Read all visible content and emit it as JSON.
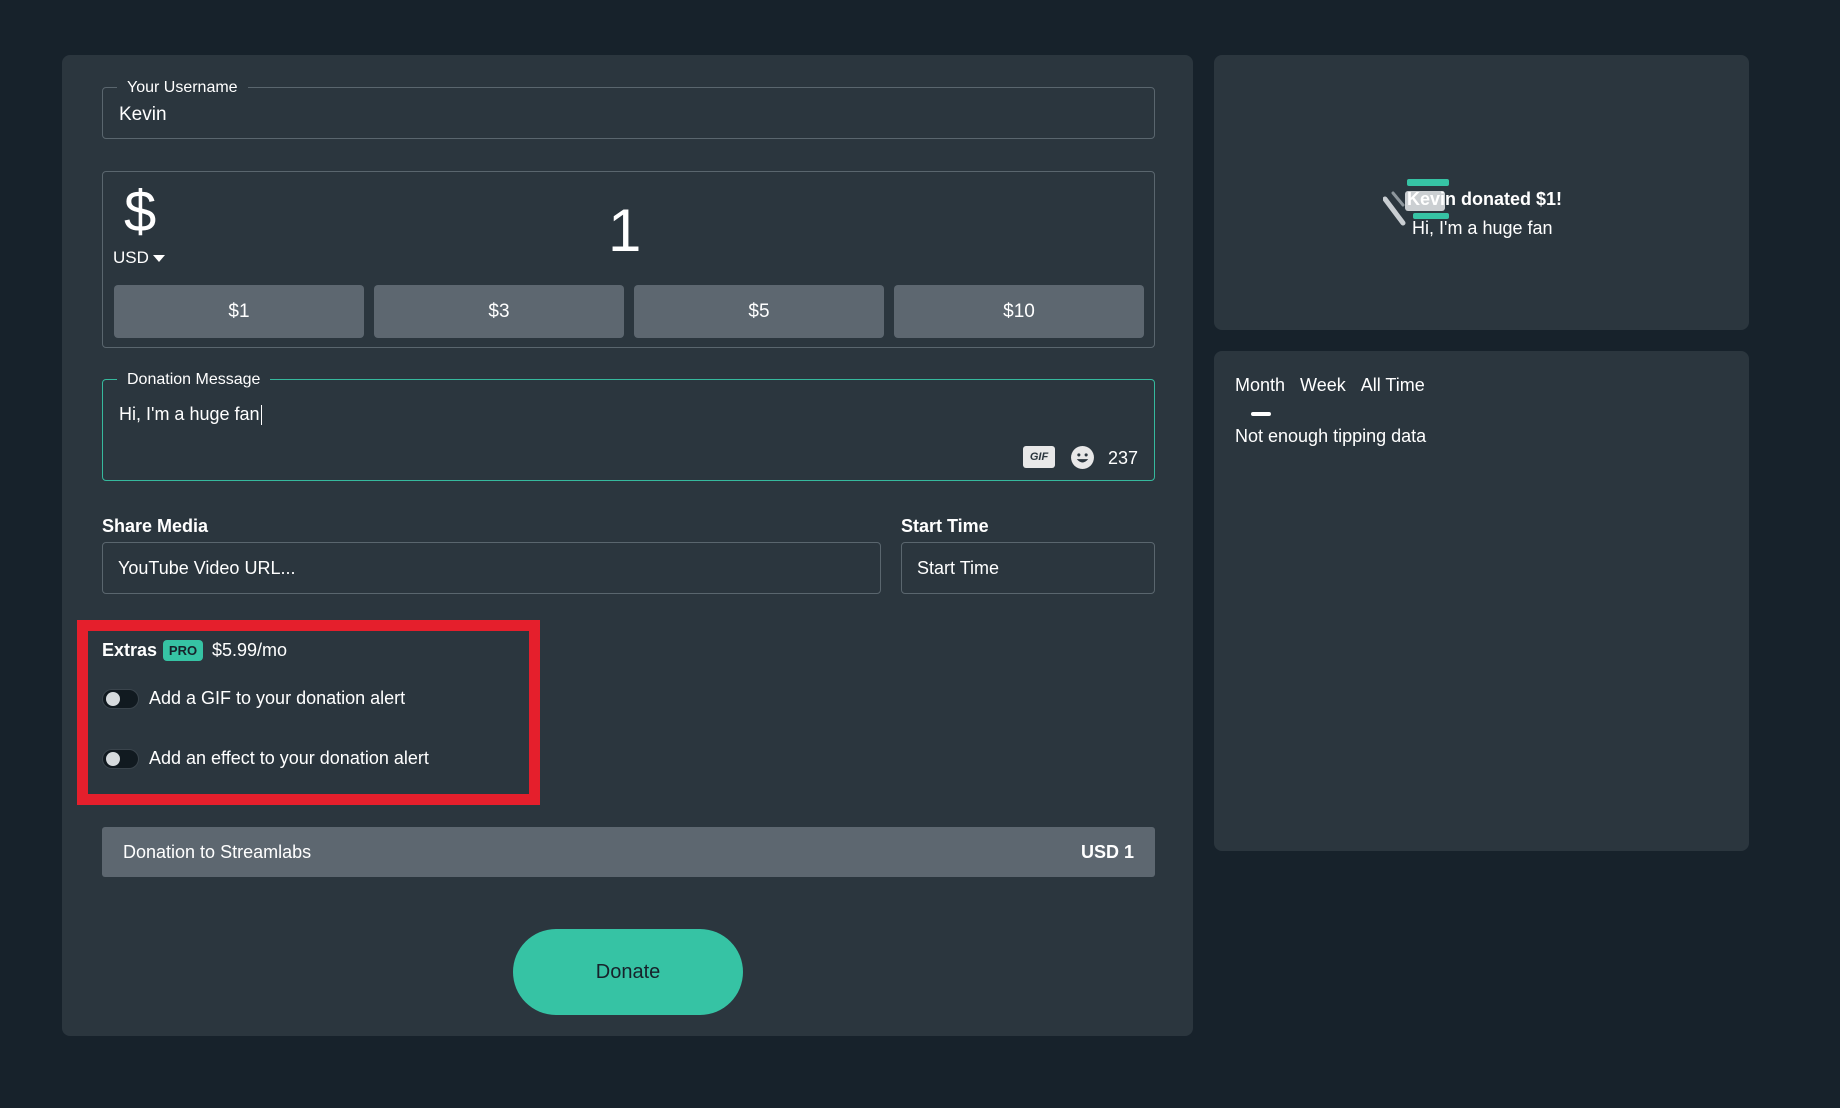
{
  "form": {
    "username_label": "Your Username",
    "username_value": "Kevin",
    "currency_symbol": "$",
    "currency": "USD",
    "amount": "1",
    "presets": [
      "$1",
      "$3",
      "$5",
      "$10"
    ],
    "message_label": "Donation Message",
    "message_value": "Hi, I'm a huge fan",
    "gif_label": "GIF",
    "char_count": "237",
    "share_media_label": "Share Media",
    "share_media_placeholder": "YouTube Video URL...",
    "start_time_label": "Start Time",
    "start_time_placeholder": "Start Time"
  },
  "extras": {
    "title": "Extras",
    "badge": "PRO",
    "price": "$5.99/mo",
    "options": [
      {
        "label": "Add a GIF to your donation alert",
        "enabled": false
      },
      {
        "label": "Add an effect to your donation alert",
        "enabled": false
      }
    ]
  },
  "summary": {
    "label": "Donation to Streamlabs",
    "total": "USD 1"
  },
  "donate_label": "Donate",
  "preview": {
    "name": "Kevin",
    "title_suffix": " donated $1!",
    "message": "Hi, I'm a huge fan"
  },
  "leaderboard": {
    "tabs": [
      "Month",
      "Week",
      "All Time"
    ],
    "empty_text": "Not enough tipping data"
  },
  "colors": {
    "accent": "#36c3a4",
    "highlight": "#e51f2c",
    "background": "#17222b",
    "panel": "#2b363e"
  }
}
